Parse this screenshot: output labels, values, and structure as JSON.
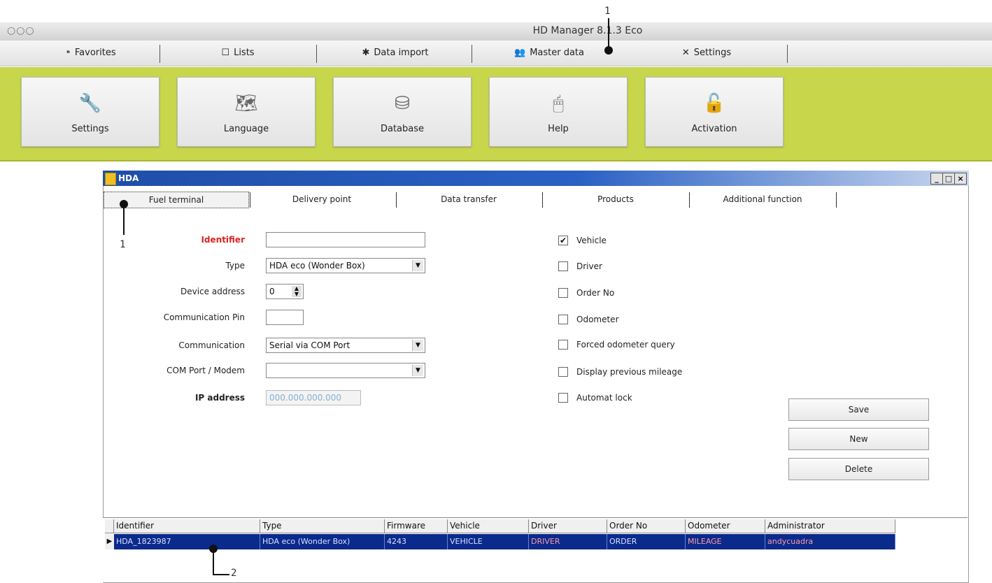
{
  "window": {
    "title": "HD Manager 8.1.3  Eco",
    "traffic_lights": "○○○"
  },
  "nav_tabs": [
    {
      "label": "Favorites",
      "icon": "⁍"
    },
    {
      "label": "Lists",
      "icon": "☐"
    },
    {
      "label": "Data import",
      "icon": "✱"
    },
    {
      "label": "Master data",
      "icon": "👥"
    },
    {
      "label": "Settings",
      "icon": "✕"
    }
  ],
  "ribbon": [
    {
      "label": "Settings",
      "icon": "🔧"
    },
    {
      "label": "Language",
      "icon": "🗺"
    },
    {
      "label": "Database",
      "icon": "⛁"
    },
    {
      "label": "Help",
      "icon": "🖱"
    },
    {
      "label": "Activation",
      "icon": "🔓"
    }
  ],
  "hda": {
    "title": "HDA",
    "controls": [
      "_",
      "□",
      "×"
    ],
    "tabs": [
      "Fuel terminal",
      "Delivery point",
      "Data transfer",
      "Products",
      "Additional function"
    ],
    "form": {
      "identifier_label": "Identifier",
      "identifier_value": "",
      "type_label": "Type",
      "type_value": "HDA eco  (Wonder Box)",
      "device_address_label": "Device address",
      "device_address_value": "0",
      "comm_pin_label": "Communication Pin",
      "comm_pin_value": "",
      "communication_label": "Communication",
      "communication_value": "Serial via COM Port",
      "com_port_label": "COM Port / Modem",
      "com_port_value": "",
      "ip_label": "IP address",
      "ip_placeholder": "000.000.000.000"
    },
    "checks": [
      {
        "label": "Vehicle",
        "checked": true
      },
      {
        "label": "Driver",
        "checked": false
      },
      {
        "label": "Order No",
        "checked": false
      },
      {
        "label": "Odometer",
        "checked": false
      },
      {
        "label": "Forced odometer query",
        "checked": false
      },
      {
        "label": "Display previous mileage",
        "checked": false
      },
      {
        "label": "Automat lock",
        "checked": false
      }
    ],
    "buttons": {
      "save": "Save",
      "new": "New",
      "delete": "Delete"
    },
    "grid": {
      "columns": [
        "Identifier",
        "Type",
        "Firmware",
        "Vehicle",
        "Driver",
        "Order No",
        "Odometer",
        "Administrator"
      ],
      "rows": [
        [
          "HDA_1823987",
          "HDA eco  (Wonder Box)",
          "4243",
          "VEHICLE",
          "DRIVER",
          "ORDER",
          "MILEAGE",
          "andycuadra"
        ]
      ]
    }
  },
  "callouts": {
    "top": "1",
    "tab": "1",
    "row": "2"
  },
  "colors": {
    "ribbon": "#c8d64c",
    "title_blue": "#1f4ea8",
    "row_select": "#0a2a8c"
  }
}
